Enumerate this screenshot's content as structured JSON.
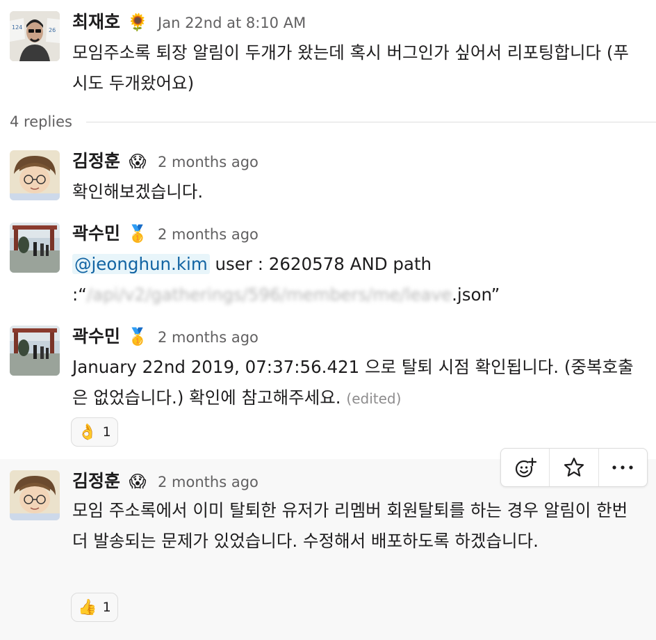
{
  "parent": {
    "author": "최재호",
    "status_emoji": "🌻",
    "timestamp": "Jan 22nd at 8:10 AM",
    "text": "모임주소록 퇴장 알림이 두개가 왔는데 혹시 버그인가 싶어서 리포팅합니다 (푸시도 두개왔어요)"
  },
  "replies_label": "4 replies",
  "replies": [
    {
      "author": "김정훈",
      "status_emoji": "😱",
      "timestamp": "2 months ago",
      "text": "확인해보겠습니다."
    },
    {
      "author": "곽수민",
      "status_emoji": "🥇",
      "timestamp": "2 months ago",
      "mention": "@jeonghun.kim",
      "text_after_mention": " user : 2620578 AND path",
      "text_line2_prefix": ":“",
      "text_line2_blurred": "/api/v2/gatherings/596/members/me/leave",
      "text_line2_suffix": ".json”"
    },
    {
      "author": "곽수민",
      "status_emoji": "🥇",
      "timestamp": "2 months ago",
      "text": "January 22nd 2019, 07:37:56.421 으로 탈퇴 시점 확인됩니다. (중복호출은 없었습니다.) 확인에 참고해주세요.",
      "edited_label": "(edited)",
      "reaction": {
        "emoji": "👌",
        "count": "1"
      }
    },
    {
      "author": "김정훈",
      "status_emoji": "😱",
      "timestamp": "2 months ago",
      "text": "모임 주소록에서 이미 탈퇴한 유저가 리멤버 회원탈퇴를 하는 경우 알림이 한번 더 발송되는 문제가 있었습니다. 수정해서 배포하도록 하겠습니다.",
      "reaction": {
        "emoji": "👍",
        "count": "1"
      }
    }
  ],
  "message_actions": {
    "icons": [
      "add-reaction-icon",
      "star-icon",
      "more-actions-icon"
    ]
  },
  "colors": {
    "mention_bg": "#e8f5fa",
    "mention_text": "#1264a3",
    "hover_bg": "#f8f8f8",
    "timestamp": "#616061"
  }
}
